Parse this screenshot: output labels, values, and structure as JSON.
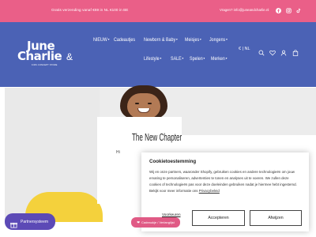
{
  "announcement": {
    "text": "Gratis verzending vanaf €69 in NL €100 in BE",
    "contact": "Vragen? info@juneandcharlie.nl",
    "social": [
      "facebook-icon",
      "instagram-icon",
      "tiktok-icon"
    ]
  },
  "brand": {
    "logo_line1": "June",
    "logo_line2": "Charlie",
    "logo_tagline": "KIDS CONCEPT STORE",
    "header_color": "#4b62b5",
    "accent_color": "#ea5f88"
  },
  "nav": {
    "row1": [
      "NIEUW",
      "Cadeautjes",
      "Newborn & Baby",
      "Meisjes",
      "Jongens"
    ],
    "row2": [
      "Lifestyle",
      "SALE",
      "Spelen",
      "Merken"
    ]
  },
  "header_utils": {
    "language": "€ | NL",
    "icons": [
      "search-icon",
      "user-icon",
      "heart-icon",
      "bag-icon",
      "cart-icon"
    ]
  },
  "hero": {
    "title": "The New Chapter",
    "subtitle": "Hi"
  },
  "cookie": {
    "title": "Cookietoestemming",
    "body": "Wij en onze partners, waaronder Shopify, gebruiken cookies en andere technologieën om jouw ervaring te personaliseren, advertenties te tonen en analyses uit te voeren. We zullen deze cookies of technologieën pas voor deze doeleinden gebruiken nadat je hiermee hebt ingestemd. Bekijk voor meer informatie ons",
    "link": "Privacybeleid",
    "preferences": "Voorkeuren",
    "accept": "Accepteren",
    "reject": "Afwijzen"
  },
  "widgets": {
    "partners": "Partnersysteem",
    "giftcard": "Cadeaukje / Verlanglijst"
  }
}
